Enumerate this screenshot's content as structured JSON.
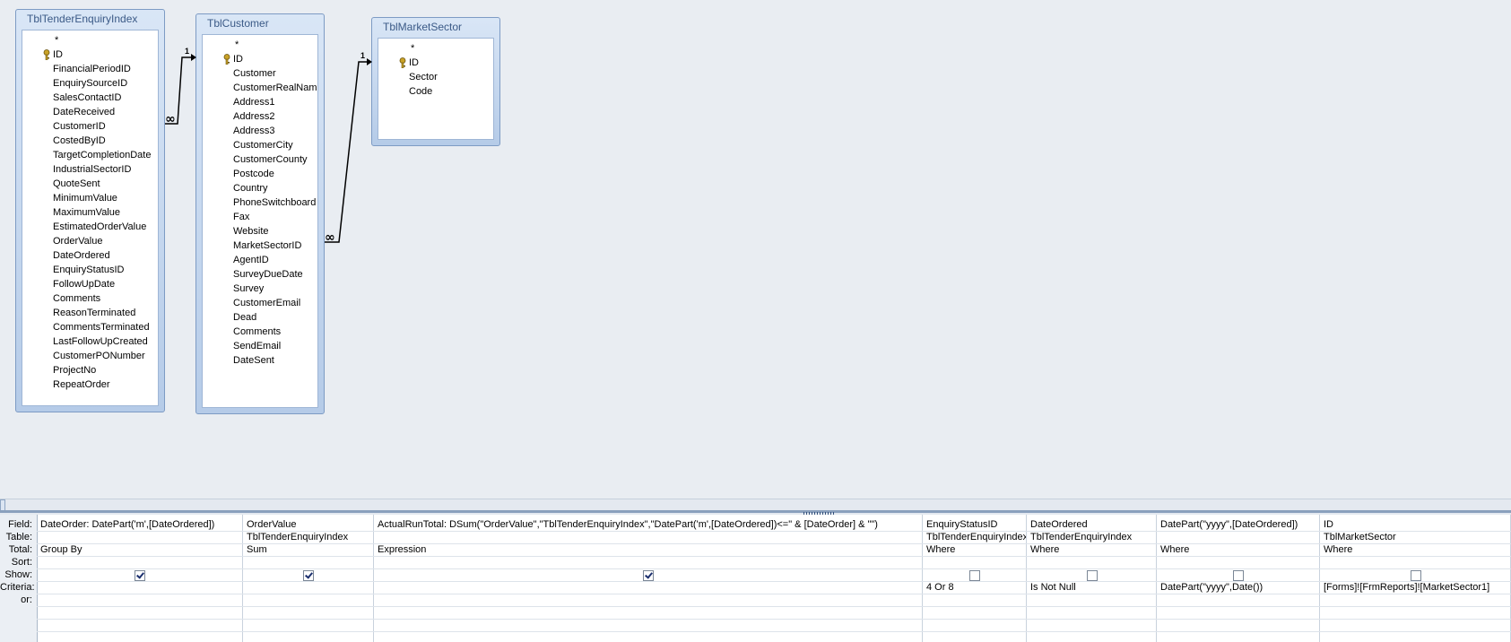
{
  "tables": [
    {
      "title": "TblTenderEnquiryIndex",
      "fields": [
        "*",
        "ID",
        "FinancialPeriodID",
        "EnquirySourceID",
        "SalesContactID",
        "DateReceived",
        "CustomerID",
        "CostedByID",
        "TargetCompletionDate",
        "IndustrialSectorID",
        "QuoteSent",
        "MinimumValue",
        "MaximumValue",
        "EstimatedOrderValue",
        "OrderValue",
        "DateOrdered",
        "EnquiryStatusID",
        "FollowUpDate",
        "Comments",
        "ReasonTerminated",
        "CommentsTerminated",
        "LastFollowUpCreated",
        "CustomerPONumber",
        "ProjectNo",
        "RepeatOrder"
      ],
      "key_field": "ID"
    },
    {
      "title": "TblCustomer",
      "fields": [
        "*",
        "ID",
        "Customer",
        "CustomerRealName",
        "Address1",
        "Address2",
        "Address3",
        "CustomerCity",
        "CustomerCounty",
        "Postcode",
        "Country",
        "PhoneSwitchboard",
        "Fax",
        "Website",
        "MarketSectorID",
        "AgentID",
        "SurveyDueDate",
        "Survey",
        "CustomerEmail",
        "Dead",
        "Comments",
        "SendEmail",
        "DateSent"
      ],
      "key_field": "ID"
    },
    {
      "title": "TblMarketSector",
      "fields": [
        "*",
        "ID",
        "Sector",
        "Code"
      ],
      "key_field": "ID"
    }
  ],
  "relationships": [
    {
      "one_label": "1",
      "many_label": "∞"
    },
    {
      "one_label": "1",
      "many_label": "∞"
    }
  ],
  "grid": {
    "row_labels": [
      "Field:",
      "Table:",
      "Total:",
      "Sort:",
      "Show:",
      "Criteria:",
      "or:"
    ],
    "columns": [
      {
        "field": "DateOrder: DatePart('m',[DateOrdered])",
        "table": "",
        "total": "Group By",
        "sort": "",
        "show": true,
        "criteria": "",
        "or": ""
      },
      {
        "field": "OrderValue",
        "table": "TblTenderEnquiryIndex",
        "total": "Sum",
        "sort": "",
        "show": true,
        "criteria": "",
        "or": ""
      },
      {
        "field": "ActualRunTotal: DSum(\"OrderValue\",\"TblTenderEnquiryIndex\",\"DatePart('m',[DateOrdered])<=\" & [DateOrder] & \"\")",
        "table": "",
        "total": "Expression",
        "sort": "",
        "show": true,
        "criteria": "",
        "or": ""
      },
      {
        "field": "EnquiryStatusID",
        "table": "TblTenderEnquiryIndex",
        "total": "Where",
        "sort": "",
        "show": false,
        "criteria": "4 Or 8",
        "or": ""
      },
      {
        "field": "DateOrdered",
        "table": "TblTenderEnquiryIndex",
        "total": "Where",
        "sort": "",
        "show": false,
        "criteria": "Is Not Null",
        "or": ""
      },
      {
        "field": "DatePart(\"yyyy\",[DateOrdered])",
        "table": "",
        "total": "Where",
        "sort": "",
        "show": false,
        "criteria": "DatePart(\"yyyy\",Date())",
        "or": ""
      },
      {
        "field": "ID",
        "table": "TblMarketSector",
        "total": "Where",
        "sort": "",
        "show": false,
        "criteria": "[Forms]![FrmReports]![MarketSector1]",
        "or": ""
      }
    ]
  },
  "colors": {
    "accent_border": "#7d9bc4",
    "title_text": "#3b5a87",
    "key_icon": "#c9a227"
  }
}
